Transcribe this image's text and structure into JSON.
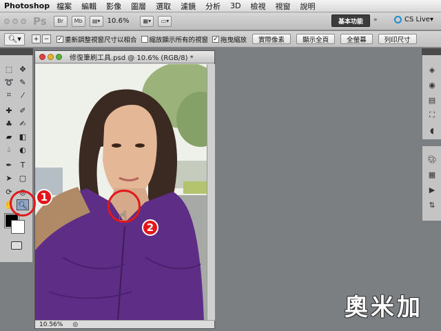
{
  "menubar": {
    "app": "Photoshop",
    "items": [
      "檔案",
      "編輯",
      "影像",
      "圖層",
      "選取",
      "濾鏡",
      "分析",
      "3D",
      "檢視",
      "視窗",
      "說明"
    ]
  },
  "appbar": {
    "logo": "Ps",
    "br": "Br",
    "mb": "Mb",
    "zoom": "10.6%",
    "workspace": "基本功能",
    "cslive": "CS Live"
  },
  "options": {
    "cb1": "重新調整視窗尺寸以相合",
    "cb2": "縮放顯示所有的視窗",
    "cb3": "拖曳縮放",
    "cb1_checked": true,
    "cb2_checked": false,
    "cb3_checked": true,
    "btn_actual": "實際像素",
    "btn_fit": "顯示全頁",
    "btn_fill": "全螢幕",
    "btn_print": "列印尺寸"
  },
  "document": {
    "title": "修復筆刷工具.psd @ 10.6% (RGB/8) *",
    "status_zoom": "10.56%"
  },
  "annotations": {
    "badge1": "1",
    "badge2": "2"
  },
  "watermark": "奧米加",
  "colors": {
    "annotation_red": "#e1171b",
    "workspace_dark": "#3c3c3c",
    "cslive_blue": "#1d8bd1"
  }
}
